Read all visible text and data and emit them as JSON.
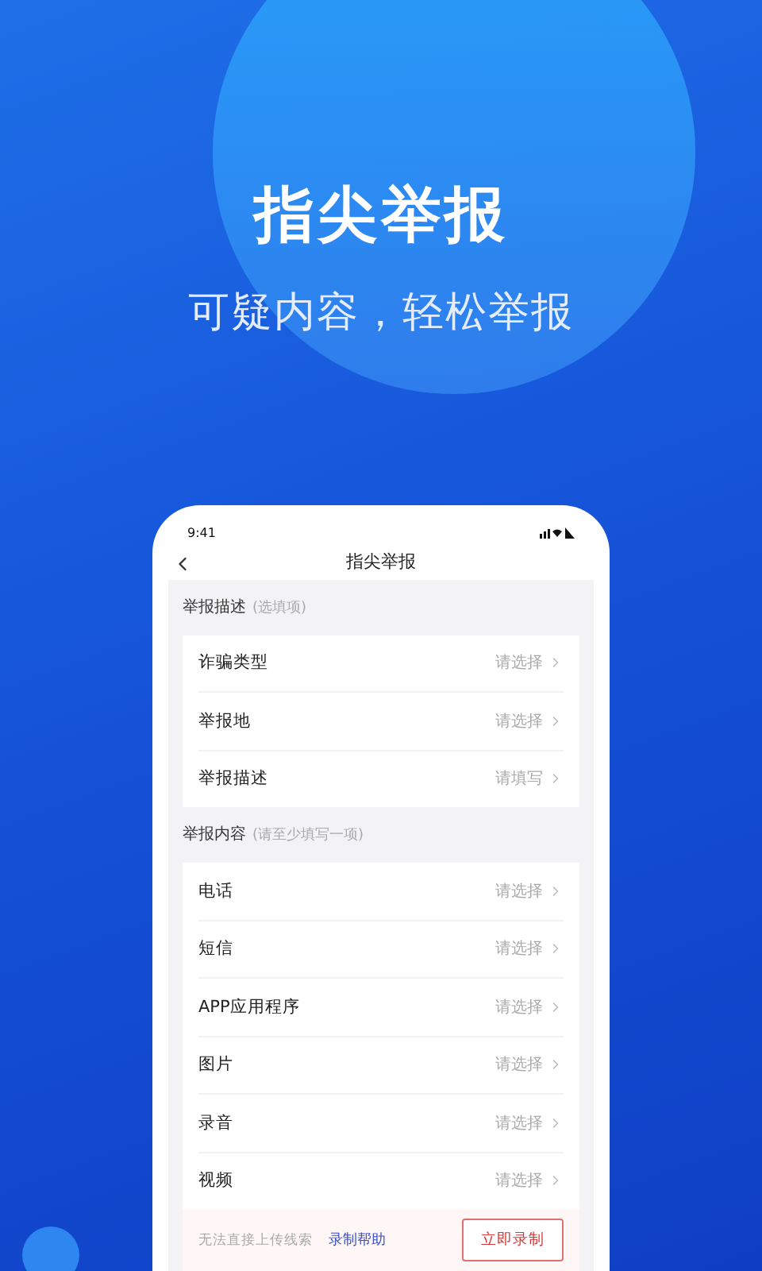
{
  "hero": {
    "title": "指尖举报",
    "subtitle": "可疑内容，轻松举报"
  },
  "phone": {
    "status_time": "9:41",
    "nav_title": "指尖举报",
    "sections": [
      {
        "title": "举报描述",
        "hint": "(选填项)",
        "rows": [
          {
            "label": "诈骗类型",
            "value": "请选择"
          },
          {
            "label": "举报地",
            "value": "请选择"
          },
          {
            "label": "举报描述",
            "value": "请填写"
          }
        ]
      },
      {
        "title": "举报内容",
        "hint": "(请至少填写一项)",
        "rows": [
          {
            "label": "电话",
            "value": "请选择"
          },
          {
            "label": "短信",
            "value": "请选择"
          },
          {
            "label": "APP应用程序",
            "value": "请选择"
          },
          {
            "label": "图片",
            "value": "请选择"
          },
          {
            "label": "录音",
            "value": "请选择"
          },
          {
            "label": "视频",
            "value": "请选择"
          }
        ]
      }
    ],
    "footer": {
      "note": "无法直接上传线索",
      "link": "录制帮助",
      "button": "立即录制"
    }
  }
}
